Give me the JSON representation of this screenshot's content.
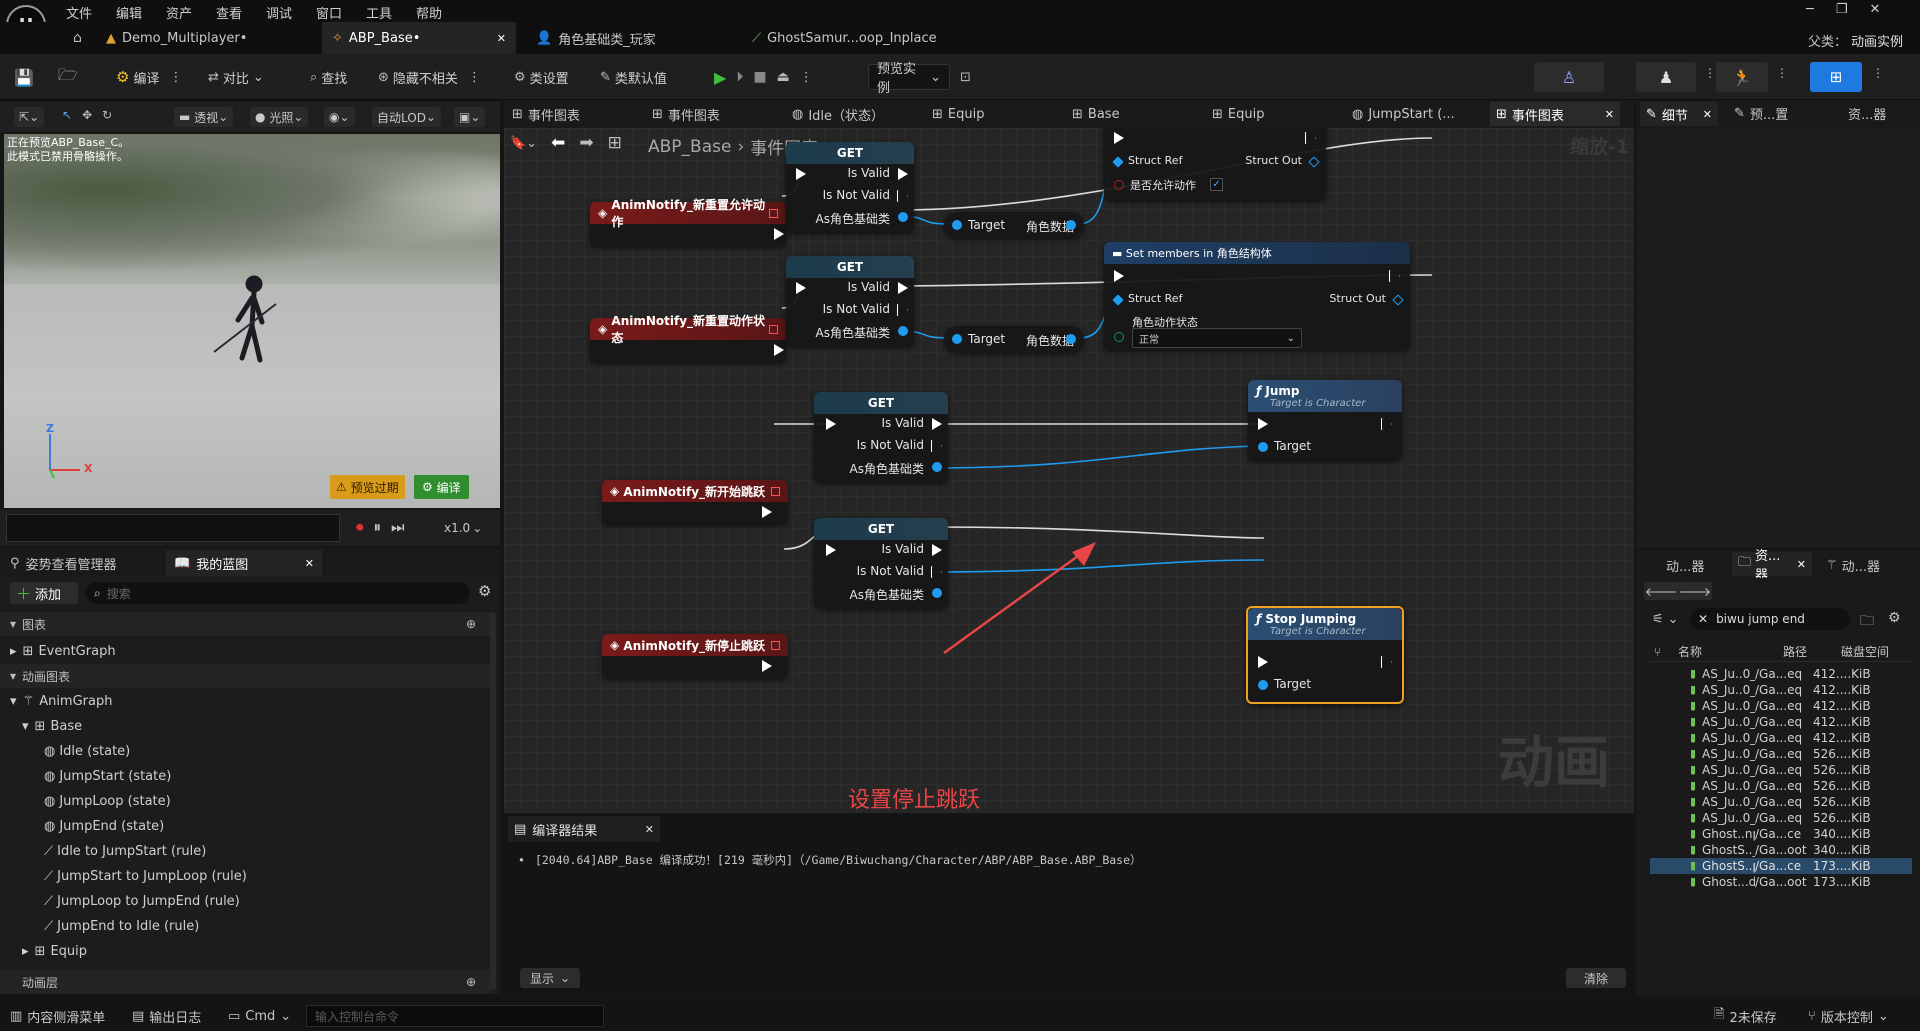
{
  "menu": [
    "文件",
    "编辑",
    "资产",
    "查看",
    "调试",
    "窗口",
    "工具",
    "帮助"
  ],
  "doc_tabs": [
    {
      "label": "Demo_Multiplayer•"
    },
    {
      "label": "ABP_Base•"
    },
    {
      "label": "角色基础类_玩家"
    },
    {
      "label": "GhostSamur...oop_Inplace"
    }
  ],
  "parent_class": {
    "label": "父类：",
    "value": "动画实例"
  },
  "toolbar": {
    "compile": "编译",
    "diff": "对比",
    "find": "查找",
    "hide_unrelated": "隐藏不相关",
    "class_settings": "类设置",
    "class_defaults": "类默认值",
    "preview_instance": "预览实例"
  },
  "viewport_toolbar": {
    "perspective": "透视",
    "lit": "光照",
    "lod": "自动LOD"
  },
  "viewport": {
    "overlay_line1": "正在预览ABP_Base_C。",
    "overlay_line2": "此模式已禁用骨骼操作。",
    "axis_z": "Z",
    "axis_x": "X",
    "preview_expired": "预览过期",
    "compile_btn": "编译"
  },
  "viewport_bottom": {
    "speed": "x1.0"
  },
  "left_tabs": {
    "pose_manager": "姿势查看管理器",
    "my_blueprint": "我的蓝图"
  },
  "left_panel": {
    "add_label": "添加",
    "search_placeholder": "搜索",
    "section_graphs": "图表",
    "event_graph": "EventGraph",
    "section_anim_graphs": "动画图表",
    "anim_graph": "AnimGraph",
    "base": "Base",
    "items": [
      "Idle (state)",
      "JumpStart (state)",
      "JumpLoop (state)",
      "JumpEnd (state)",
      "Idle to JumpStart (rule)",
      "JumpStart to JumpLoop (rule)",
      "JumpLoop to JumpEnd (rule)",
      "JumpEnd to Idle (rule)"
    ],
    "equip": "Equip",
    "section_anim_layers": "动画层"
  },
  "graph_tabs": [
    "事件图表",
    "事件图表",
    "Idle（状态）",
    "Equip",
    "Base",
    "Equip",
    "JumpStart (...",
    "事件图表"
  ],
  "graph": {
    "breadcrumb_root": "ABP_Base",
    "breadcrumb_leaf": "事件图表",
    "zoom": "缩放-1",
    "watermark": "动画",
    "notify1": "AnimNotify_新重置允许动作",
    "notify2": "AnimNotify_新重置动作状态",
    "notify3": "AnimNotify_新开始跳跃",
    "notify4": "AnimNotify_新停止跳跃",
    "get": "GET",
    "is_valid": "Is Valid",
    "is_not_valid": "Is Not Valid",
    "as_char": "As角色基础类",
    "target": "Target",
    "char_data": "角色数据",
    "set_members": "Set members in 角色结构体",
    "struct_ref": "Struct Ref",
    "struct_out": "Struct Out",
    "allow_action": "是否允许动作",
    "action_state": "角色动作状态",
    "action_state_value": "正常",
    "jump": "Jump",
    "jump_sub": "Target is Character",
    "stop_jumping": "Stop Jumping",
    "stop_sub": "Target is Character",
    "annotation": "设置停止跳跃"
  },
  "compiler": {
    "tab": "编译器结果",
    "message": "[2040.64]ABP_Base 编译成功！[219 毫秒内]（/Game/Biwuchang/Character/ABP/ABP_Base.ABP_Base）",
    "show": "显示",
    "clear": "清除"
  },
  "right_top_tabs": {
    "details": "细节",
    "preview": "预...置",
    "assets": "资...器"
  },
  "right_mid_tabs": {
    "anim": "动...器",
    "assets": "资...器",
    "anim2": "动...器"
  },
  "content": {
    "search_value": "biwu jump end",
    "col_name": "名称",
    "col_path": "路径",
    "col_size": "磁盘空间",
    "rows": [
      {
        "name": "AS_Ju..0_Seq",
        "path": "/Ga...eq",
        "size": "412....KiB"
      },
      {
        "name": "AS_Ju..0_Seq",
        "path": "/Ga...eq",
        "size": "412....KiB"
      },
      {
        "name": "AS_Ju..0_Seq",
        "path": "/Ga...eq",
        "size": "412....KiB"
      },
      {
        "name": "AS_Ju..0_Seq",
        "path": "/Ga...eq",
        "size": "412....KiB"
      },
      {
        "name": "AS_Ju..0_Seq",
        "path": "/Ga...eq",
        "size": "412....KiB"
      },
      {
        "name": "AS_Ju..0_Seq",
        "path": "/Ga...eq",
        "size": "526....KiB"
      },
      {
        "name": "AS_Ju..0_Seq",
        "path": "/Ga...eq",
        "size": "526....KiB"
      },
      {
        "name": "AS_Ju..0_Seq",
        "path": "/Ga...eq",
        "size": "526....KiB"
      },
      {
        "name": "AS_Ju..0_Seq",
        "path": "/Ga...eq",
        "size": "526....KiB"
      },
      {
        "name": "AS_Ju..0_Seq",
        "path": "/Ga...eq",
        "size": "526....KiB"
      },
      {
        "name": "Ghost..nplace",
        "path": "/Ga...ce",
        "size": "340....KiB"
      },
      {
        "name": "GhostS.._Root",
        "path": "/Ga...oot",
        "size": "340....KiB"
      },
      {
        "name": "GhostS..place",
        "path": "/Ga...ce",
        "size": "173....KiB"
      },
      {
        "name": "Ghost...d_Root",
        "path": "/Ga...oot",
        "size": "173....KiB"
      }
    ]
  },
  "statusbar": {
    "drawer": "内容侧滑菜单",
    "output_log": "输出日志",
    "cmd": "Cmd",
    "cmd_placeholder": "输入控制台命令",
    "unsaved": "2未保存",
    "source_control": "版本控制"
  }
}
